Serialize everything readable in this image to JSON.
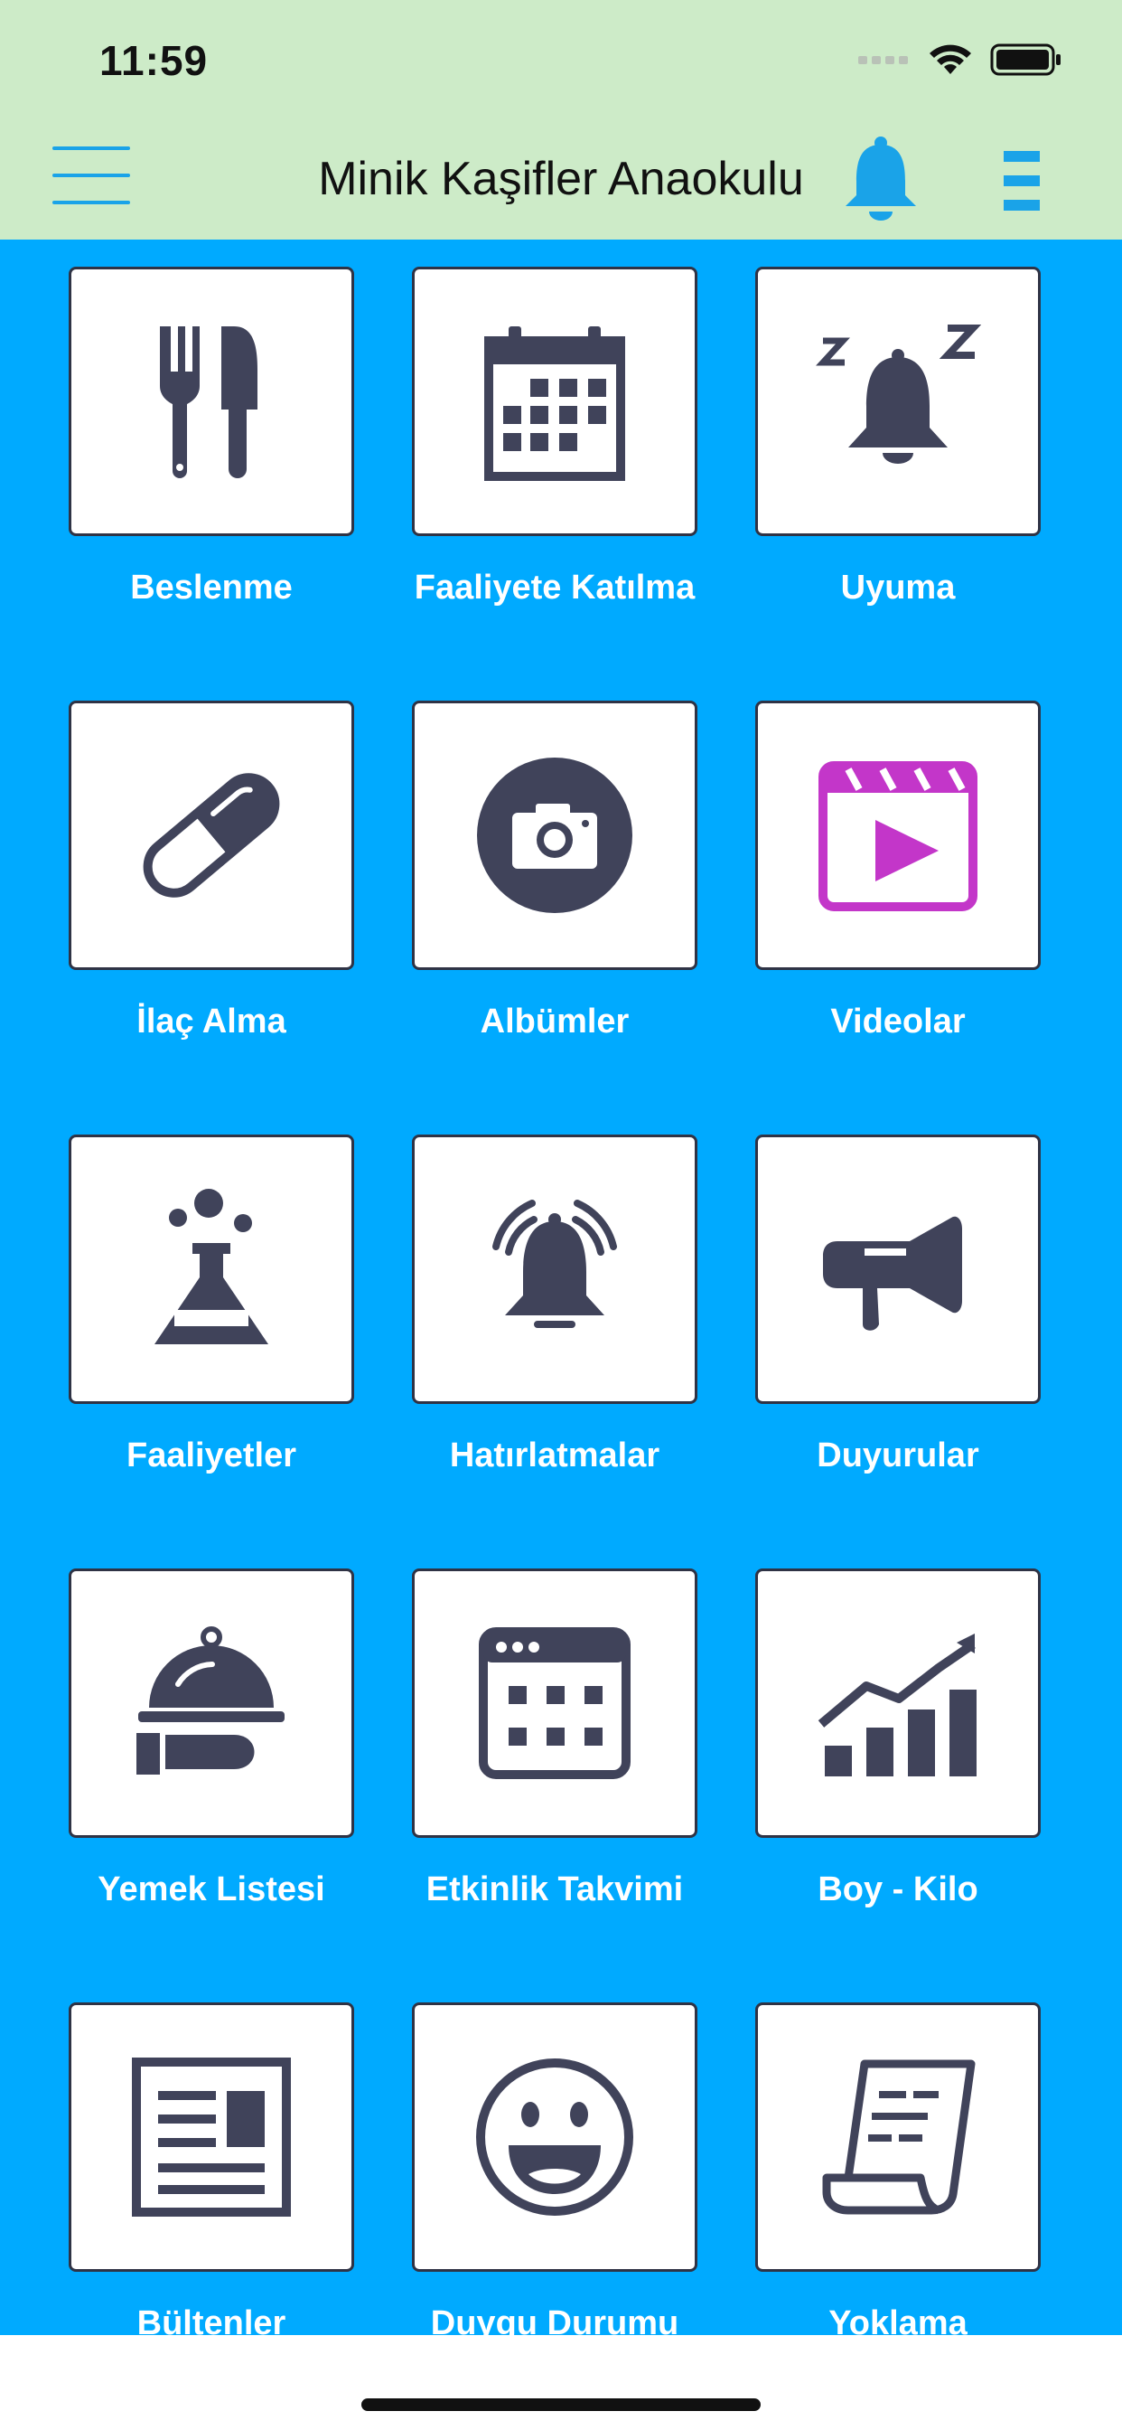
{
  "status_bar": {
    "time": "11:59"
  },
  "header": {
    "title": "Minik Kaşifler Anaokulu"
  },
  "tiles": [
    {
      "label": "Beslenme",
      "icon": "fork-knife-icon"
    },
    {
      "label": "Faaliyete Katılma",
      "icon": "calendar-icon"
    },
    {
      "label": "Uyuma",
      "icon": "sleeping-bell-icon"
    },
    {
      "label": "İlaç Alma",
      "icon": "pill-icon"
    },
    {
      "label": "Albümler",
      "icon": "camera-icon"
    },
    {
      "label": "Videolar",
      "icon": "video-clapper-icon",
      "icon_color": "#c336c9"
    },
    {
      "label": "Faaliyetler",
      "icon": "flask-icon"
    },
    {
      "label": "Hatırlatmalar",
      "icon": "ringing-bell-icon"
    },
    {
      "label": "Duyurular",
      "icon": "megaphone-icon"
    },
    {
      "label": "Yemek Listesi",
      "icon": "food-cloche-icon"
    },
    {
      "label": "Etkinlik Takvimi",
      "icon": "event-calendar-icon"
    },
    {
      "label": "Boy - Kilo",
      "icon": "growth-chart-icon"
    },
    {
      "label": "Bültenler",
      "icon": "newspaper-icon"
    },
    {
      "label": "Duygu Durumu",
      "icon": "smiley-icon"
    },
    {
      "label": "Yoklama",
      "icon": "scroll-list-icon"
    }
  ],
  "colors": {
    "header_bg": "#cdebc8",
    "content_bg": "#00aaff",
    "icon_dark": "#40435a",
    "accent_blue": "#1aa3e8",
    "video_magenta": "#c336c9"
  }
}
